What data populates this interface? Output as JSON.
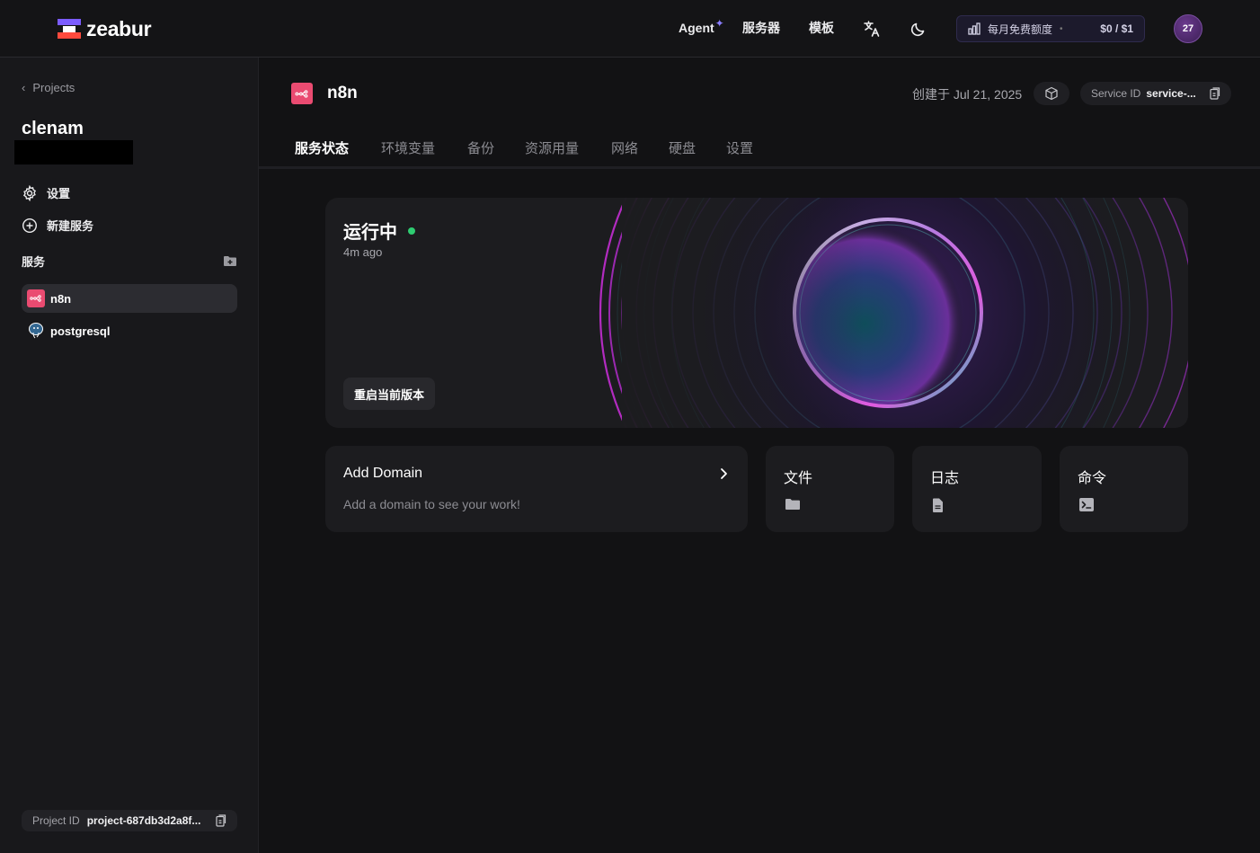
{
  "brand": {
    "name": "zeabur"
  },
  "topbar": {
    "agent_label": "Agent",
    "agent_spark": "✦",
    "servers_label": "服务器",
    "templates_label": "模板",
    "language_icon": "translate-icon",
    "theme_icon": "moon-icon",
    "quota_label": "每月免费额度",
    "quota_value": "$0 / $1",
    "avatar_text": "27"
  },
  "sidebar": {
    "back_label": "Projects",
    "project_name": "clenam",
    "links": [
      {
        "label": "设置",
        "icon": "gear-icon"
      },
      {
        "label": "新建服务",
        "icon": "plus-circle-icon"
      }
    ],
    "services_header": "服务",
    "services": [
      {
        "label": "n8n",
        "icon": "n8n-icon",
        "active": true
      },
      {
        "label": "postgresql",
        "icon": "postgresql-icon",
        "active": false
      }
    ],
    "project_id_label": "Project ID",
    "project_id_value": "project-687db3d2a8f..."
  },
  "service": {
    "title": "n8n",
    "created": "创建于 Jul 21, 2025",
    "service_id_label": "Service ID",
    "service_id_value": "service-..."
  },
  "tabs": [
    {
      "label": "服务状态",
      "active": true
    },
    {
      "label": "环境变量",
      "active": false
    },
    {
      "label": "备份",
      "active": false
    },
    {
      "label": "资源用量",
      "active": false
    },
    {
      "label": "网络",
      "active": false
    },
    {
      "label": "硬盘",
      "active": false
    },
    {
      "label": "设置",
      "active": false
    }
  ],
  "hero": {
    "status": "运行中",
    "time": "4m ago",
    "restart_label": "重启当前版本",
    "status_color": "#2ecc71"
  },
  "cards": {
    "domain_title": "Add Domain",
    "domain_sub": "Add a domain to see your work!",
    "files_title": "文件",
    "logs_title": "日志",
    "command_title": "命令"
  },
  "colors": {
    "accent_n8n": "#ea4b71",
    "background": "#121214",
    "surface": "#1c1c1f"
  }
}
